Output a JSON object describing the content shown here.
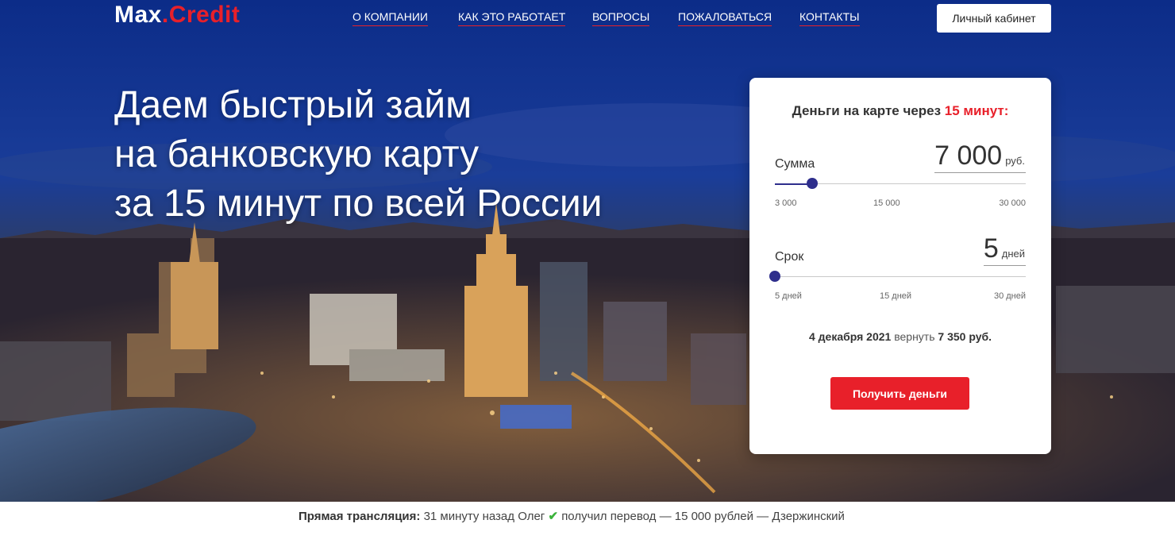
{
  "brand": {
    "logo_left": "Max",
    "logo_dot": ".",
    "logo_right": "Credit"
  },
  "nav": [
    {
      "label": "О КОМПАНИИ"
    },
    {
      "label": "КАК ЭТО РАБОТАЕТ"
    },
    {
      "label": "ВОПРОСЫ"
    },
    {
      "label": "ПОЖАЛОВАТЬСЯ"
    },
    {
      "label": "КОНТАКТЫ"
    }
  ],
  "cabinet_button": "Личный кабинет",
  "headline": [
    "Даем быстрый займ",
    "на банковскую карту",
    "за 15 минут по всей России"
  ],
  "calculator": {
    "title_prefix": "Деньги на карте через",
    "title_highlight": "15 минут:",
    "amount": {
      "label": "Сумма",
      "value": "7 000",
      "unit": "руб.",
      "min": 3000,
      "max": 30000,
      "current": 7000,
      "ticks": [
        "3 000",
        "15 000",
        "30 000"
      ]
    },
    "term": {
      "label": "Срок",
      "value": "5",
      "unit": "дней",
      "min": 5,
      "max": 30,
      "current": 5,
      "ticks": [
        "5 дней",
        "15 дней",
        "30 дней"
      ]
    },
    "summary_date": "4 декабря 2021",
    "summary_mid": "вернуть",
    "summary_amount": "7 350 руб.",
    "button": "Получить деньги"
  },
  "ticker": {
    "label": "Прямая трансляция:",
    "part1": "31 минуту назад Олег",
    "check": "✔",
    "part2": "получил перевод — 15 000 рублей — Дзержинский"
  },
  "colors": {
    "accent": "#e8202a",
    "slider": "#2e2e8c",
    "check": "#3bb33b"
  }
}
